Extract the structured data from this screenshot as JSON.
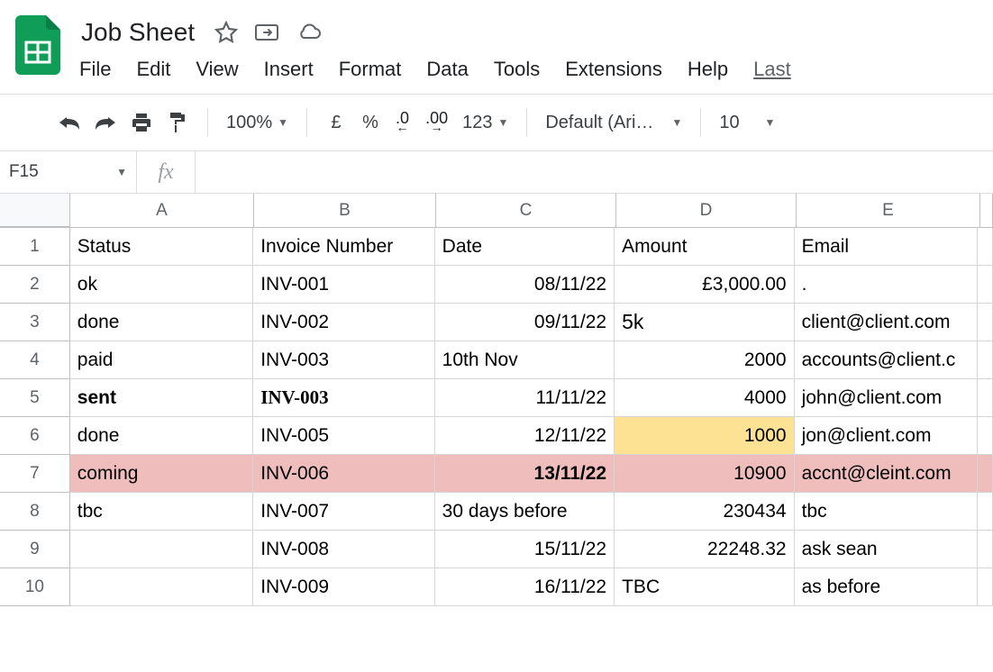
{
  "doc": {
    "title": "Job Sheet"
  },
  "menus": [
    "File",
    "Edit",
    "View",
    "Insert",
    "Format",
    "Data",
    "Tools",
    "Extensions",
    "Help",
    "Last"
  ],
  "toolbar": {
    "zoom": "100%",
    "currency": "£",
    "percent": "%",
    "numfmt": "123",
    "font": "Default (Ari…",
    "fontsize": "10"
  },
  "namebox": "F15",
  "fx": "fx",
  "columns": [
    "A",
    "B",
    "C",
    "D",
    "E"
  ],
  "rowNums": [
    "1",
    "2",
    "3",
    "4",
    "5",
    "6",
    "7",
    "8",
    "9",
    "10"
  ],
  "chart_data": {
    "type": "table",
    "headers": [
      "Status",
      "Invoice Number",
      "Date",
      "Amount",
      "Email"
    ],
    "rows": [
      {
        "status": "ok",
        "invoice": "INV-001",
        "date": "08/11/22",
        "amount": "£3,000.00",
        "email": "."
      },
      {
        "status": "done",
        "invoice": "INV-002",
        "date": "09/11/22",
        "amount": "5k",
        "email": "client@client.com"
      },
      {
        "status": "paid",
        "invoice": "INV-003",
        "date": "10th Nov",
        "amount": "2000",
        "email": "accounts@client.c"
      },
      {
        "status": "sent",
        "invoice": "INV-003",
        "date": "11/11/22",
        "amount": "4000",
        "email": "john@client.com"
      },
      {
        "status": "done",
        "invoice": "INV-005",
        "date": "12/11/22",
        "amount": "1000",
        "email": "jon@client.com"
      },
      {
        "status": "coming",
        "invoice": "INV-006",
        "date": "13/11/22",
        "amount": "10900",
        "email": "accnt@cleint.com"
      },
      {
        "status": "tbc",
        "invoice": "INV-007",
        "date": "30 days before",
        "amount": "230434",
        "email": "tbc"
      },
      {
        "status": "",
        "invoice": "INV-008",
        "date": "15/11/22",
        "amount": "22248.32",
        "email": "ask sean"
      },
      {
        "status": "",
        "invoice": "INV-009",
        "date": "16/11/22",
        "amount": "TBC",
        "email": "as before"
      }
    ]
  }
}
